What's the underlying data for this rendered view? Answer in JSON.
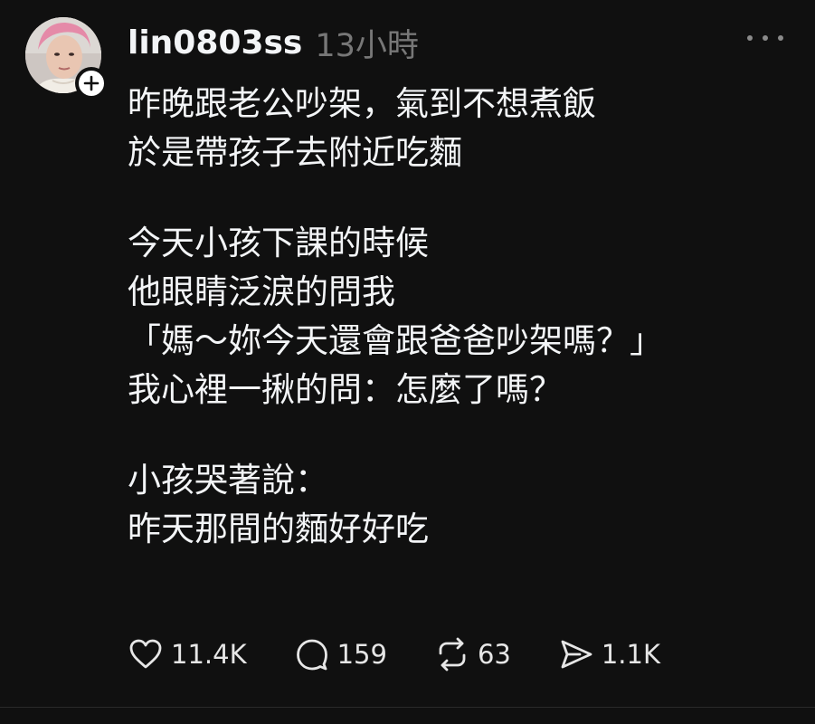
{
  "post": {
    "username": "lin0803ss",
    "timestamp": "13小時",
    "paragraphs": [
      [
        "昨晚跟老公吵架，氣到不想煮飯",
        "於是帶孩子去附近吃麵"
      ],
      [
        "今天小孩下課的時候",
        "他眼睛泛淚的問我",
        "「媽～妳今天還會跟爸爸吵架嗎？」",
        "我心裡一揪的問：怎麼了嗎？"
      ],
      [
        "小孩哭著說：",
        "昨天那間的麵好好吃"
      ]
    ]
  },
  "actions": {
    "like": {
      "icon": "heart-icon",
      "count": "11.4K"
    },
    "reply": {
      "icon": "comment-icon",
      "count": "159"
    },
    "repost": {
      "icon": "repost-icon",
      "count": "63"
    },
    "share": {
      "icon": "send-icon",
      "count": "1.1K"
    }
  },
  "colors": {
    "background": "#101010",
    "text": "#f3f5f7",
    "muted": "#777777"
  }
}
